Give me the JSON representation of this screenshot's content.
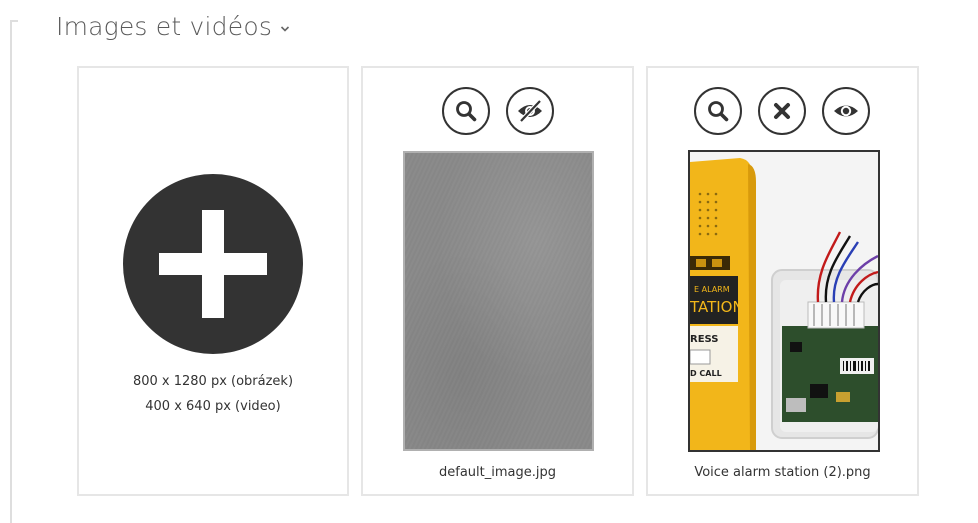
{
  "section": {
    "title": "Images et vidéos"
  },
  "add_card": {
    "dim_image": "800 x 1280 px (obrázek)",
    "dim_video": "400 x 640 px (video)"
  },
  "cards": [
    {
      "filename": "default_image.jpg",
      "actions": [
        "zoom-icon",
        "eye-slash-icon"
      ]
    },
    {
      "filename": "Voice alarm station (2).png",
      "actions": [
        "zoom-icon",
        "close-icon",
        "eye-icon"
      ]
    }
  ],
  "voice_image_text": {
    "line1": "E ALARM",
    "line2": "TATION",
    "line3": "RESS",
    "line4": "D CALL"
  },
  "colors": {
    "dark": "#333333",
    "card_border": "#e6e6e6",
    "device_yellow": "#f2b61a"
  }
}
